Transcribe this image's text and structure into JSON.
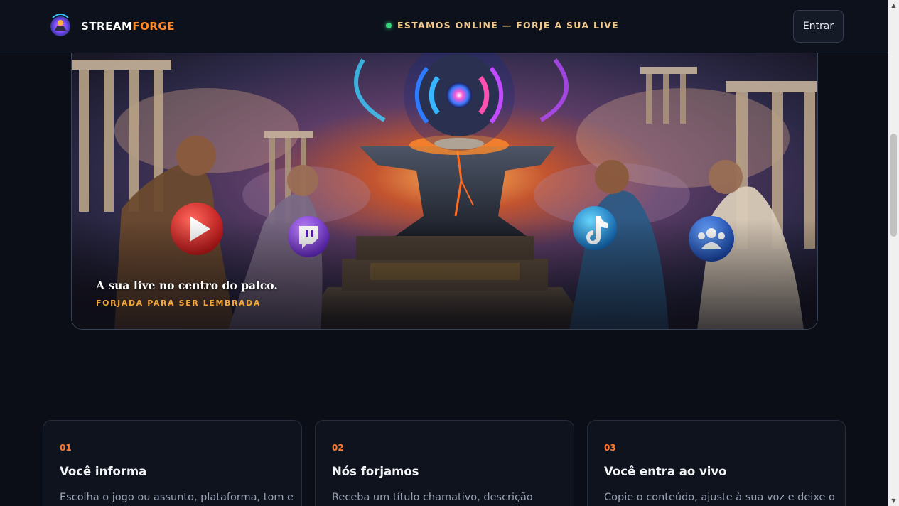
{
  "header": {
    "brand_part1": "STREAM",
    "brand_part2": "FORGE",
    "status_text": "ESTAMOS ONLINE — FORJE A SUA LIVE",
    "login_label": "Entrar"
  },
  "hero": {
    "title": "A sua live no centro do palco.",
    "subtitle": "FORJADA PARA SER LEMBRADA"
  },
  "steps": [
    {
      "num": "01",
      "title": "Você informa",
      "desc": "Escolha o jogo ou assunto, plataforma, tom e"
    },
    {
      "num": "02",
      "title": "Nós forjamos",
      "desc": "Receba um título chamativo, descrição"
    },
    {
      "num": "03",
      "title": "Você entra ao vivo",
      "desc": "Copie o conteúdo, ajuste à sua voz e deixe o"
    }
  ],
  "colors": {
    "accent": "#ff8a2a",
    "status_online": "#36d27a",
    "background": "#0b0e16"
  },
  "icons": [
    "logo-icon",
    "status-dot-icon",
    "youtube-icon",
    "twitch-icon",
    "tiktok-icon",
    "community-icon",
    "broadcast-icon"
  ]
}
